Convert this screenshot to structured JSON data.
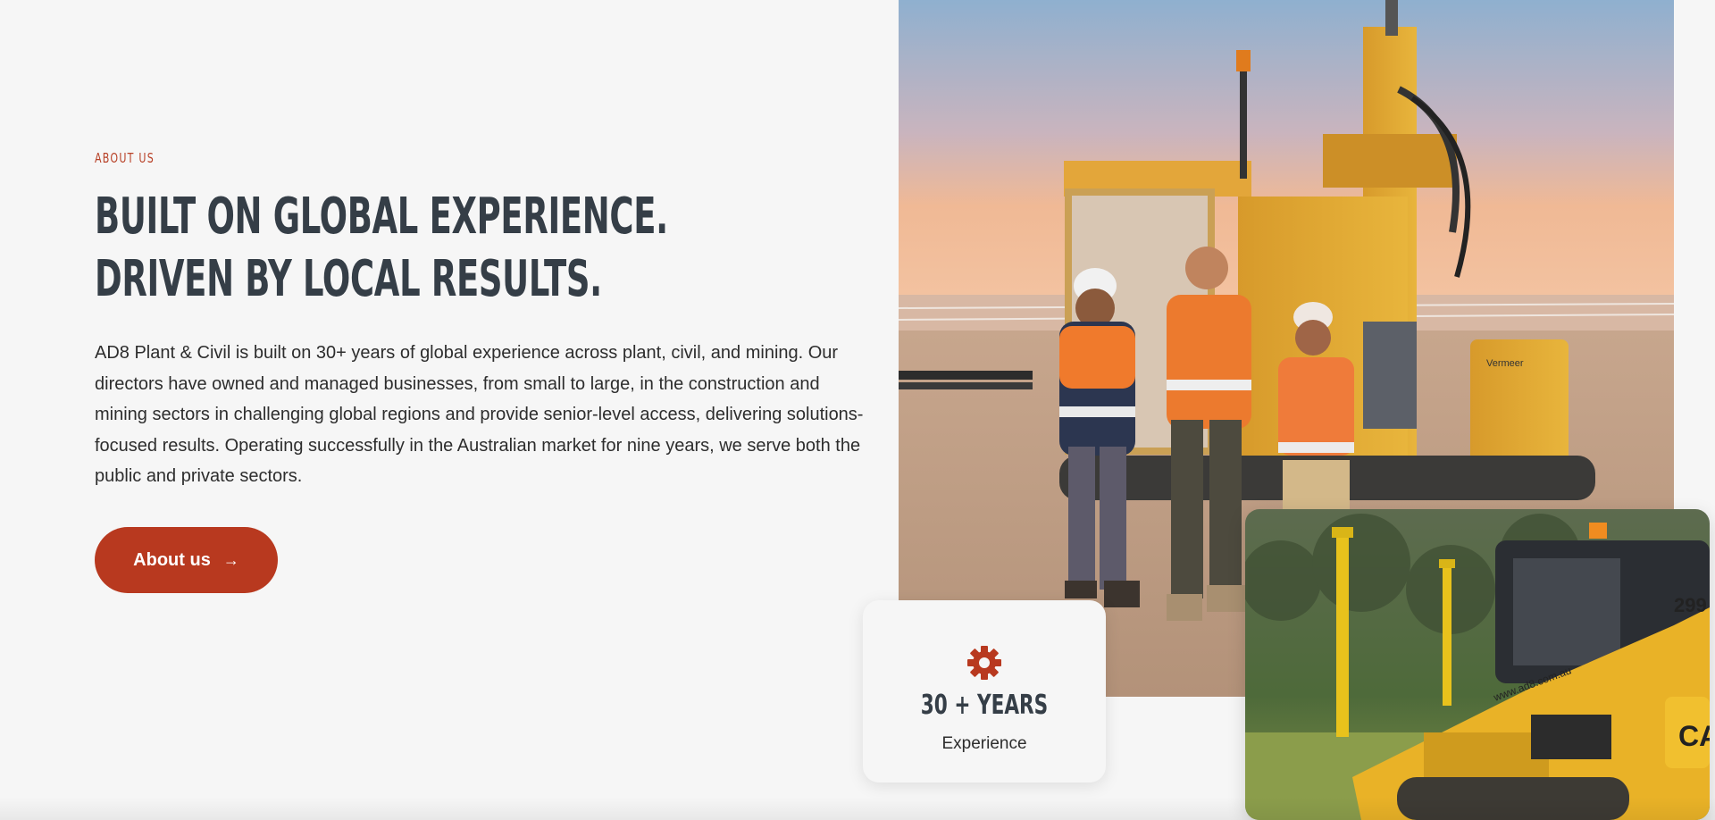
{
  "about": {
    "eyebrow": "ABOUT US",
    "headline": "BUILT ON GLOBAL EXPERIENCE. DRIVEN BY LOCAL RESULTS.",
    "body": "AD8 Plant & Civil is built on 30+ years of global experience across plant, civil, and mining. Our directors have owned and managed businesses, from small to large, in the construction and mining sectors in challenging global regions and provide senior-level access, delivering solutions-focused results. Operating successfully in the Australian market for nine years, we serve both the public and private sectors.",
    "cta_label": "About us",
    "cta_icon": "arrow-right-icon"
  },
  "stat": {
    "icon": "gear-icon",
    "value": "30 + YEARS",
    "label": "Experience"
  },
  "images": {
    "main_alt": "Three workers in hi-vis gear in front of a yellow drilling rig at sunset",
    "secondary_alt": "Yellow compact track loader with survey poles",
    "loader_website": "www.ad8.com.au",
    "loader_number": "299",
    "rig_brand": "Vermeer",
    "loader_brand": "CA"
  },
  "colors": {
    "accent": "#b8391f",
    "heading": "#353e47",
    "text": "#2d2d2d",
    "background": "#f6f6f6"
  }
}
